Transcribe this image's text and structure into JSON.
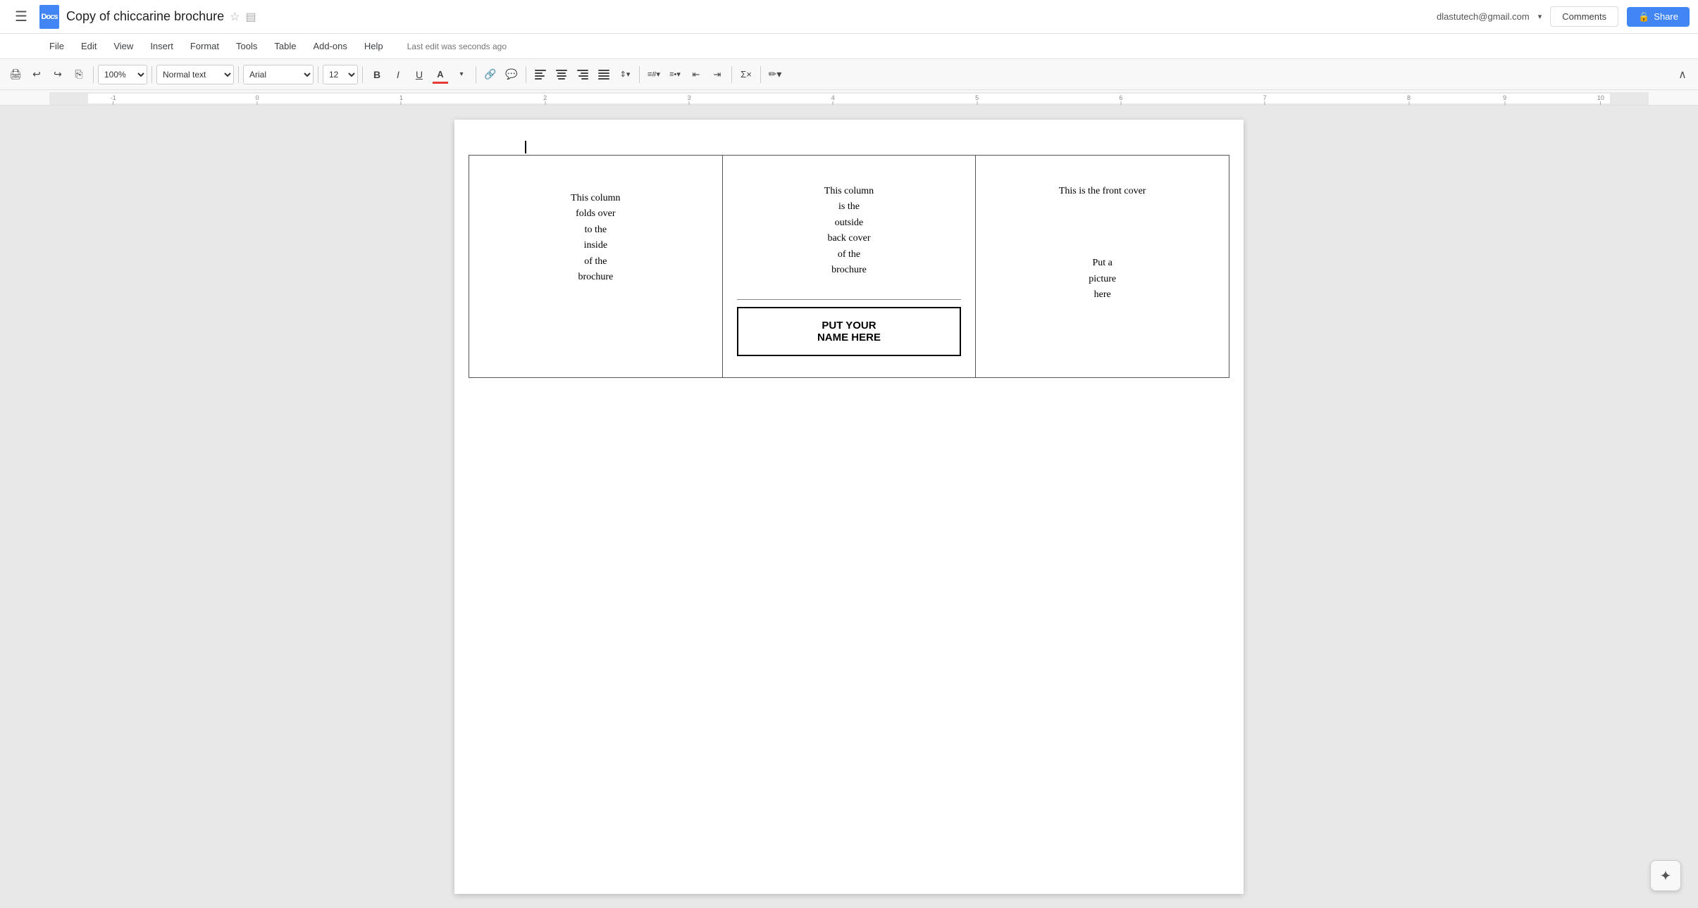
{
  "topbar": {
    "title": "Copy of chiccarine brochure",
    "star_icon": "☆",
    "folder_icon": "▤",
    "user_email": "dlastutech@gmail.com",
    "dropdown_arrow": "▾",
    "comments_label": "Comments",
    "share_label": "Share",
    "share_icon": "🔒"
  },
  "menubar": {
    "items": [
      "File",
      "Edit",
      "View",
      "Insert",
      "Format",
      "Tools",
      "Table",
      "Add-ons",
      "Help"
    ],
    "last_edit": "Last edit was seconds ago"
  },
  "toolbar": {
    "print": "⎙",
    "undo": "↩",
    "redo": "↪",
    "format_paint": "🖌",
    "zoom": "100%",
    "style": "Normal text",
    "font": "Arial",
    "size": "12",
    "bold": "B",
    "italic": "I",
    "underline": "U",
    "text_color": "A",
    "link": "🔗",
    "comment": "💬",
    "align_left": "≡",
    "align_center": "≡",
    "align_right": "≡",
    "align_justify": "≡",
    "line_spacing": "↕",
    "numbered_list": "1.",
    "bullet_list": "•",
    "indent_decrease": "←",
    "indent_increase": "→",
    "formula": "∑",
    "pen": "✏",
    "collapse": "∧"
  },
  "ruler": {
    "marks": [
      "-1",
      "0",
      "1",
      "2",
      "3",
      "4",
      "5",
      "6",
      "7",
      "8",
      "9",
      "10"
    ]
  },
  "brochure": {
    "col_left": {
      "line1": "This column",
      "line2": "folds over",
      "line3": "to the",
      "line4": "inside",
      "line5": "of the",
      "line6": "brochure"
    },
    "col_mid": {
      "outside_text_line1": "This column",
      "outside_text_line2": "is the",
      "outside_text_line3": "outside",
      "outside_text_line4": "back cover",
      "outside_text_line5": "of the",
      "outside_text_line6": "brochure",
      "name_box_line1": "PUT YOUR",
      "name_box_line2": "NAME HERE"
    },
    "col_right": {
      "front_cover": "This is the front cover",
      "picture_line1": "Put a",
      "picture_line2": "picture",
      "picture_line3": "here"
    }
  },
  "ai_btn": "✦"
}
